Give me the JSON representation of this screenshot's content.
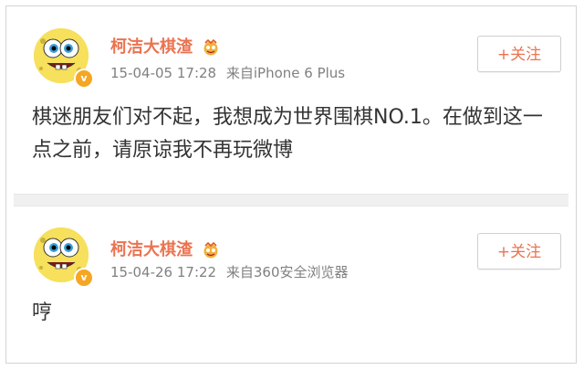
{
  "posts": [
    {
      "author": "柯洁大棋渣",
      "verified_mark": "v",
      "timestamp": "15-04-05 17:28",
      "source": "来自iPhone 6 Plus",
      "follow_label": "+关注",
      "text": "棋迷朋友们对不起，我想成为世界围棋NO.1。在做到这一点之前，请原谅我不再玩微博"
    },
    {
      "author": "柯洁大棋渣",
      "verified_mark": "v",
      "timestamp": "15-04-26 17:22",
      "source": "来自360安全浏览器",
      "follow_label": "+关注",
      "text": "哼"
    }
  ],
  "colors": {
    "accent": "#eb7350",
    "avatar_yellow": "#f6e05c",
    "badge": "#f5a623"
  }
}
